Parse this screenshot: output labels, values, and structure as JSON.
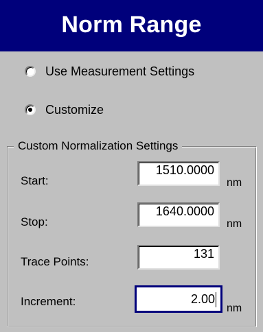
{
  "title": "Norm Range",
  "options": {
    "use_measurement_label": "Use Measurement Settings",
    "customize_label": "Customize",
    "selected": "Customize"
  },
  "group": {
    "label": "Custom Normalization Settings"
  },
  "fields": {
    "start": {
      "label": "Start:",
      "value": "1510.0000",
      "unit": "nm"
    },
    "stop": {
      "label": "Stop:",
      "value": "1640.0000",
      "unit": "nm"
    },
    "trace_points": {
      "label": "Trace Points:",
      "value": "131"
    },
    "increment": {
      "label": "Increment:",
      "value": "2.00",
      "unit": "nm"
    }
  },
  "colors": {
    "title_bar": "#00007b",
    "panel": "#c0c0c0",
    "focus_border": "#00007b"
  }
}
